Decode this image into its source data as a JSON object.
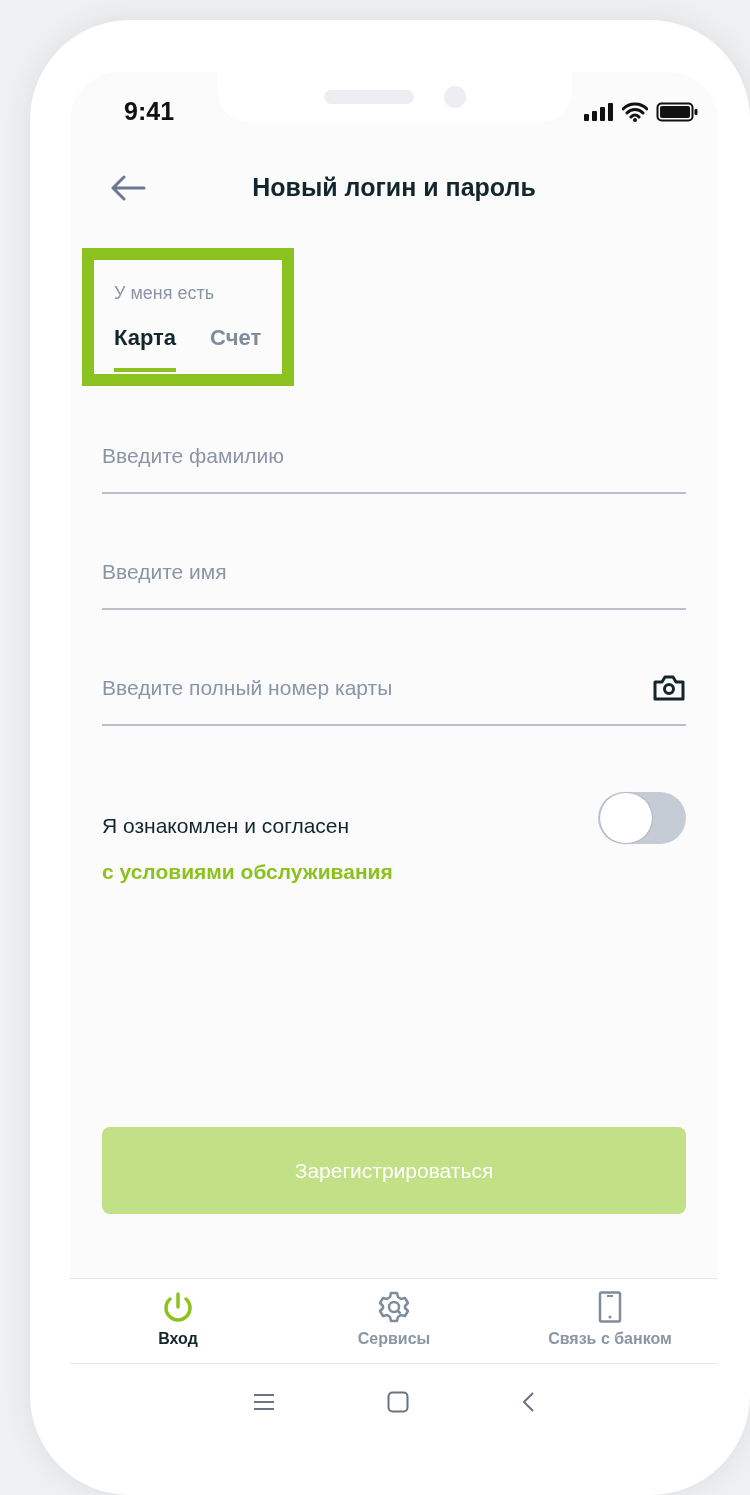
{
  "status_bar": {
    "time": "9:41"
  },
  "header": {
    "title": "Новый логин и пароль"
  },
  "account_type": {
    "label": "У меня есть",
    "highlighted": true,
    "tabs": [
      {
        "label": "Карта",
        "selected": true
      },
      {
        "label": "Счет",
        "selected": false
      }
    ]
  },
  "fields": [
    {
      "kind": "text",
      "placeholder": "Введите фамилию"
    },
    {
      "kind": "text",
      "placeholder": "Введите имя"
    },
    {
      "kind": "card",
      "placeholder": "Введите полный номер карты"
    }
  ],
  "agreement": {
    "text": "Я ознакомлен и согласен",
    "link": "с условиями обслуживания",
    "on": false
  },
  "submit": {
    "label": "Зарегистрироваться",
    "disabled": true
  },
  "bottom_nav": [
    {
      "kind": "power",
      "label": "Вход",
      "selected": true
    },
    {
      "kind": "gear",
      "label": "Сервисы",
      "selected": false
    },
    {
      "kind": "phone",
      "label": "Связь с банком",
      "selected": false
    }
  ]
}
